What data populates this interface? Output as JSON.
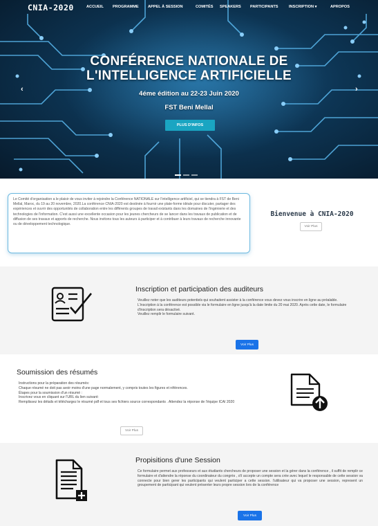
{
  "header": {
    "brand": "CNIA-2020",
    "nav": [
      "ACCUEIL",
      "PROGRAMME",
      "APPEL À SESSION",
      "COMITÉS",
      "SPEAKERS",
      "PARTICIPANTS",
      "INSCRIPTION ▾",
      "APROPOS"
    ]
  },
  "hero": {
    "title_line1": "CONFÉRENCE NATIONALE DE",
    "title_line2": "L'INTELLIGENCE ARTIFICIELLE",
    "subtitle": "4éme édition au 22-23 Juin 2020",
    "location": "FST Beni Mellal",
    "cta": "PLUS D'INFOS",
    "prev": "‹",
    "next": "›"
  },
  "welcome": {
    "text": "Le Comité d'organisation a le plaisir de vous inviter à rejoindre la Conférence NATIONALE sur l'intelligence artificiel, qui se tiendra à FST de Beni Mellal, Maroc, du 19 au 20 novembre, 2020.La conférence CNIA-2020 est destinée à fournir une plate-forme idéale pour discuter, partager des expériences et ouvrir des opportunités de collaboration entre les différents groupes de travail existants dans les domaines de l'ingénierie et des technologies de l'information. C'est aussi une excellente occasion pour les jeunes chercheurs de se lancer dans les travaux de publication et de diffusion de ses travaux et apports de recherche. Nous invitons tous les auteurs à participer et à contribuer à leurs travaux de recherche innovante ou de développement technologique.",
    "title": "Bienvenue à CNIA-2020",
    "button": "Voir Plus"
  },
  "inscription": {
    "title": "Inscription et participation des auditeurs",
    "lines": [
      "Veuillez noter que les auditeurs potentiels qui souhaitent assister à la conférence   vous devez vous inscrire en ligne au préalable.",
      "L'inscription à la conférence est possible   via le formulaire en ligne jusqu'à la date limite du 20 mai 2020. Après cette date,   le formulaire d'inscription sera désactivé.",
      "Veuillez remplir le formulaire suivant."
    ],
    "button": "Voir Plus",
    "icon": "form-checklist-icon"
  },
  "resumes": {
    "title": "Soumission des résumés",
    "lines": [
      "Instructions pour la préparation des résumés:",
      "Chaque résumé ne doit pas avoir moins d'une page normalement, y compris toutes les figures et références.",
      "Étapes pour la soumission d'un résumé :",
      "Inscrivez vous en cliquant sur l'URL du lien suivant:",
      "Remplissez les détails et téléchargez le résumé pdf et tous ses fichiers source correspondants . Attendez la réponse de l'équipe ICAI 2020"
    ],
    "button": "Voir Plus",
    "icon": "document-upload-icon"
  },
  "session": {
    "title": "Propisitions d'une Session",
    "text": "Ce formulaire permet aux professeurs et aux étudiants chercheurs de proposer une session et la gérer dans la conférence , il suffit de remplir ce formulaire et d'attendre la réponse du coordinateur du congrès , s'il accepte un compte sera crée avec lequel le responsable de cette session va connecte pour bien gerer les participants qui veulent participer a cette session. l'utilisateur qui va proposer une session, represent un groupement de participant qui veulent présenter leurs propre session lors de la conférence",
    "button": "Voir Plus",
    "icon": "document-add-icon"
  },
  "colors": {
    "accent": "#1a73e8",
    "hero_button": "#1aa5c2",
    "box_border": "#6bb8e0"
  }
}
